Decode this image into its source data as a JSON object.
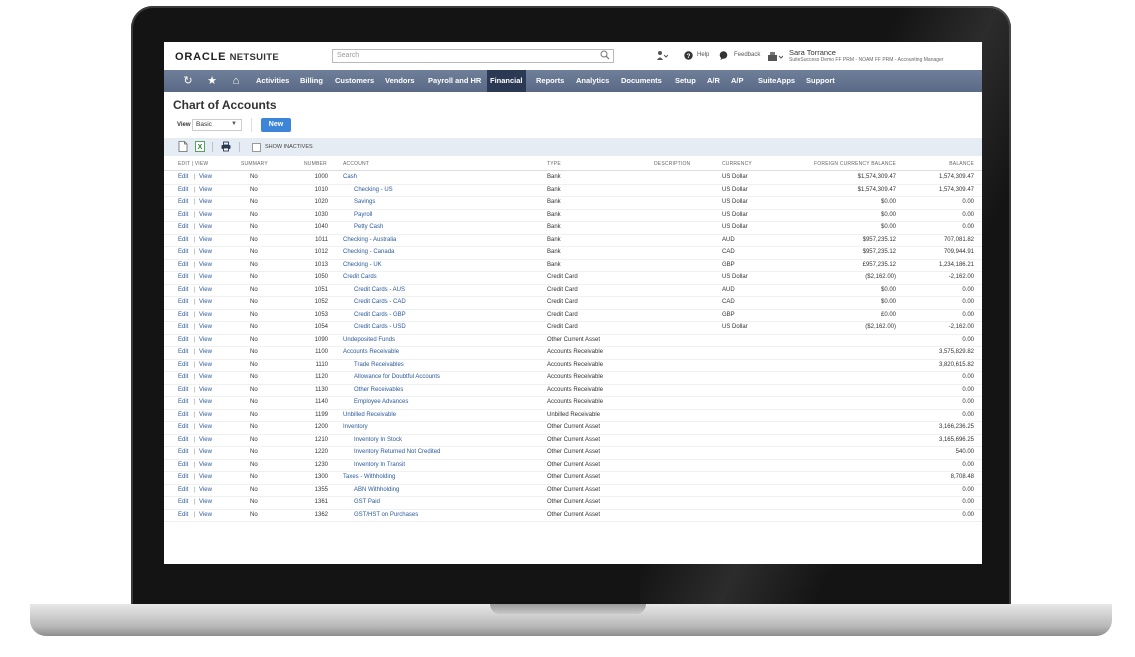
{
  "header": {
    "logo_part1": "ORACLE",
    "logo_part2": "NETSUITE",
    "search_placeholder": "Search",
    "help_label": "Help",
    "feedback_label": "Feedback",
    "user_name": "Sara Torrance",
    "user_role": "SuiteSuccess Demo FF PRM - NOAM FF PRM - Accounting Manager"
  },
  "nav": {
    "items": [
      "Activities",
      "Billing",
      "Customers",
      "Vendors",
      "Payroll and HR",
      "Financial",
      "Reports",
      "Analytics",
      "Documents",
      "Setup",
      "A/R",
      "A/P",
      "SuiteApps",
      "Support"
    ],
    "active": "Financial"
  },
  "page": {
    "title": "Chart of Accounts",
    "view_label": "View",
    "view_value": "Basic",
    "new_button": "New",
    "show_inactives": "SHOW INACTIVES"
  },
  "table": {
    "headers": {
      "edit_view": "EDIT | VIEW",
      "summary": "SUMMARY",
      "number": "NUMBER",
      "account": "ACCOUNT",
      "type": "TYPE",
      "description": "DESCRIPTION",
      "currency": "CURRENCY",
      "fc_balance": "FOREIGN CURRENCY BALANCE",
      "balance": "BALANCE"
    },
    "edit_label": "Edit",
    "view_label": "View",
    "rows": [
      {
        "summary": "No",
        "number": "1000",
        "account": "Cash",
        "indent": 0,
        "type": "Bank",
        "currency": "US Dollar",
        "fc_balance": "$1,574,309.47",
        "balance": "1,574,309.47"
      },
      {
        "summary": "No",
        "number": "1010",
        "account": "Checking - US",
        "indent": 1,
        "type": "Bank",
        "currency": "US Dollar",
        "fc_balance": "$1,574,309.47",
        "balance": "1,574,309.47"
      },
      {
        "summary": "No",
        "number": "1020",
        "account": "Savings",
        "indent": 1,
        "type": "Bank",
        "currency": "US Dollar",
        "fc_balance": "$0.00",
        "balance": "0.00"
      },
      {
        "summary": "No",
        "number": "1030",
        "account": "Payroll",
        "indent": 1,
        "type": "Bank",
        "currency": "US Dollar",
        "fc_balance": "$0.00",
        "balance": "0.00"
      },
      {
        "summary": "No",
        "number": "1040",
        "account": "Petty Cash",
        "indent": 1,
        "type": "Bank",
        "currency": "US Dollar",
        "fc_balance": "$0.00",
        "balance": "0.00"
      },
      {
        "summary": "No",
        "number": "1011",
        "account": "Checking - Australia",
        "indent": 0,
        "type": "Bank",
        "currency": "AUD",
        "fc_balance": "$957,235.12",
        "balance": "707,081.82"
      },
      {
        "summary": "No",
        "number": "1012",
        "account": "Checking - Canada",
        "indent": 0,
        "type": "Bank",
        "currency": "CAD",
        "fc_balance": "$957,235.12",
        "balance": "709,944.91"
      },
      {
        "summary": "No",
        "number": "1013",
        "account": "Checking - UK",
        "indent": 0,
        "type": "Bank",
        "currency": "GBP",
        "fc_balance": "£957,235.12",
        "balance": "1,234,186.21"
      },
      {
        "summary": "No",
        "number": "1050",
        "account": "Credit Cards",
        "indent": 0,
        "type": "Credit Card",
        "currency": "US Dollar",
        "fc_balance": "($2,162.00)",
        "balance": "-2,162.00"
      },
      {
        "summary": "No",
        "number": "1051",
        "account": "Credit Cards - AUS",
        "indent": 1,
        "type": "Credit Card",
        "currency": "AUD",
        "fc_balance": "$0.00",
        "balance": "0.00"
      },
      {
        "summary": "No",
        "number": "1052",
        "account": "Credit Cards - CAD",
        "indent": 1,
        "type": "Credit Card",
        "currency": "CAD",
        "fc_balance": "$0.00",
        "balance": "0.00"
      },
      {
        "summary": "No",
        "number": "1053",
        "account": "Credit Cards - GBP",
        "indent": 1,
        "type": "Credit Card",
        "currency": "GBP",
        "fc_balance": "£0.00",
        "balance": "0.00"
      },
      {
        "summary": "No",
        "number": "1054",
        "account": "Credit Cards - USD",
        "indent": 1,
        "type": "Credit Card",
        "currency": "US Dollar",
        "fc_balance": "($2,162.00)",
        "balance": "-2,162.00"
      },
      {
        "summary": "No",
        "number": "1090",
        "account": "Undeposited Funds",
        "indent": 0,
        "type": "Other Current Asset",
        "currency": "",
        "fc_balance": "",
        "balance": "0.00"
      },
      {
        "summary": "No",
        "number": "1100",
        "account": "Accounts Receivable",
        "indent": 0,
        "type": "Accounts Receivable",
        "currency": "",
        "fc_balance": "",
        "balance": "3,575,829.82"
      },
      {
        "summary": "No",
        "number": "1110",
        "account": "Trade Receivables",
        "indent": 1,
        "type": "Accounts Receivable",
        "currency": "",
        "fc_balance": "",
        "balance": "3,820,615.82"
      },
      {
        "summary": "No",
        "number": "1120",
        "account": "Allowance for Doubtful Accounts",
        "indent": 1,
        "type": "Accounts Receivable",
        "currency": "",
        "fc_balance": "",
        "balance": "0.00"
      },
      {
        "summary": "No",
        "number": "1130",
        "account": "Other Receivables",
        "indent": 1,
        "type": "Accounts Receivable",
        "currency": "",
        "fc_balance": "",
        "balance": "0.00"
      },
      {
        "summary": "No",
        "number": "1140",
        "account": "Employee Advances",
        "indent": 1,
        "type": "Accounts Receivable",
        "currency": "",
        "fc_balance": "",
        "balance": "0.00"
      },
      {
        "summary": "No",
        "number": "1199",
        "account": "Unbilled Receivable",
        "indent": 0,
        "type": "Unbilled Receivable",
        "currency": "",
        "fc_balance": "",
        "balance": "0.00"
      },
      {
        "summary": "No",
        "number": "1200",
        "account": "Inventory",
        "indent": 0,
        "type": "Other Current Asset",
        "currency": "",
        "fc_balance": "",
        "balance": "3,166,236.25"
      },
      {
        "summary": "No",
        "number": "1210",
        "account": "Inventory In Stock",
        "indent": 1,
        "type": "Other Current Asset",
        "currency": "",
        "fc_balance": "",
        "balance": "3,165,696.25"
      },
      {
        "summary": "No",
        "number": "1220",
        "account": "Inventory Returned Not Credited",
        "indent": 1,
        "type": "Other Current Asset",
        "currency": "",
        "fc_balance": "",
        "balance": "540.00"
      },
      {
        "summary": "No",
        "number": "1230",
        "account": "Inventory In Transit",
        "indent": 1,
        "type": "Other Current Asset",
        "currency": "",
        "fc_balance": "",
        "balance": "0.00"
      },
      {
        "summary": "No",
        "number": "1300",
        "account": "Taxes - Withholding",
        "indent": 0,
        "type": "Other Current Asset",
        "currency": "",
        "fc_balance": "",
        "balance": "8,708.48"
      },
      {
        "summary": "No",
        "number": "1355",
        "account": "ABN Withholding",
        "indent": 1,
        "type": "Other Current Asset",
        "currency": "",
        "fc_balance": "",
        "balance": "0.00"
      },
      {
        "summary": "No",
        "number": "1361",
        "account": "GST Paid",
        "indent": 1,
        "type": "Other Current Asset",
        "currency": "",
        "fc_balance": "",
        "balance": "0.00"
      },
      {
        "summary": "No",
        "number": "1362",
        "account": "GST/HST on Purchases",
        "indent": 1,
        "type": "Other Current Asset",
        "currency": "",
        "fc_balance": "",
        "balance": "0.00"
      }
    ]
  },
  "colors": {
    "nav_bg": "#5f6f8c",
    "nav_active": "#2c3954",
    "link": "#2b5a9b",
    "new_button": "#3d85d8",
    "toolbar_bg": "#e6ecf3"
  },
  "icons": {
    "nav": [
      "history-icon",
      "star-icon",
      "home-icon"
    ],
    "toolbar": [
      "new-document-icon",
      "excel-export-icon",
      "print-icon"
    ]
  }
}
